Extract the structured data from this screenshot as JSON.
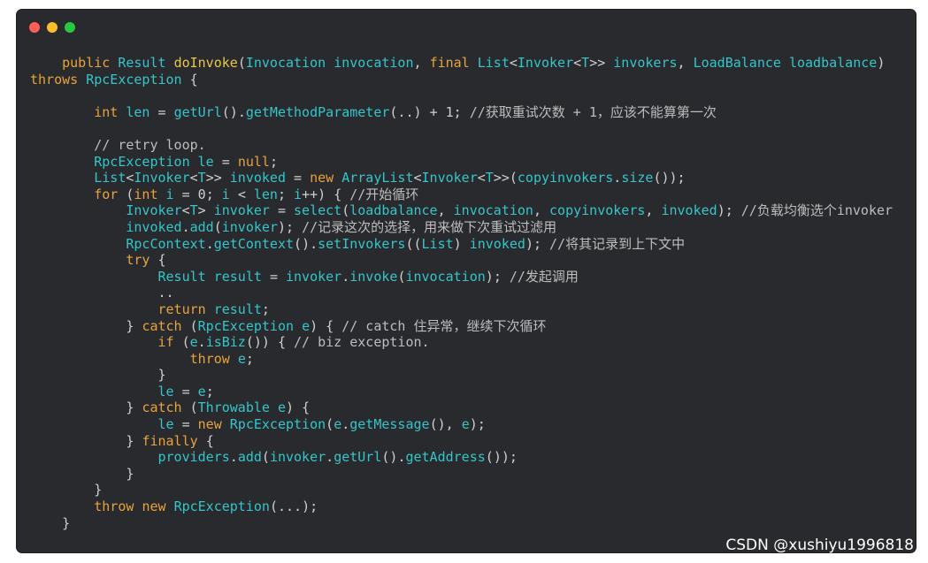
{
  "window": {
    "buttons": [
      {
        "name": "close",
        "color": "#ff5f57"
      },
      {
        "name": "minimize",
        "color": "#febc2e"
      },
      {
        "name": "maximize",
        "color": "#28c840"
      }
    ]
  },
  "code": {
    "lines": [
      "    public Result doInvoke(Invocation invocation, final List<Invoker<T>> invokers, LoadBalance loadbalance)",
      "throws RpcException {",
      "",
      "        int len = getUrl().getMethodParameter(..) + 1; //获取重试次数 + 1，应该不能算第一次",
      "",
      "        // retry loop.",
      "        RpcException le = null;",
      "        List<Invoker<T>> invoked = new ArrayList<Invoker<T>>(copyinvokers.size());",
      "        for (int i = 0; i < len; i++) { //开始循环",
      "            Invoker<T> invoker = select(loadbalance, invocation, copyinvokers, invoked); //负载均衡选个invoker",
      "            invoked.add(invoker); //记录这次的选择，用来做下次重试过滤用",
      "            RpcContext.getContext().setInvokers((List) invoked); //将其记录到上下文中",
      "            try {",
      "                Result result = invoker.invoke(invocation); //发起调用",
      "                ..",
      "                return result;",
      "            } catch (RpcException e) { // catch 住异常，继续下次循环",
      "                if (e.isBiz()) { // biz exception.",
      "                    throw e;",
      "                }",
      "                le = e;",
      "            } catch (Throwable e) {",
      "                le = new RpcException(e.getMessage(), e);",
      "            } finally {",
      "                providers.add(invoker.getUrl().getAddress());",
      "            }",
      "        }",
      "        throw new RpcException(...);",
      "    }"
    ]
  },
  "watermark": "CSDN @xushiyu1996818"
}
